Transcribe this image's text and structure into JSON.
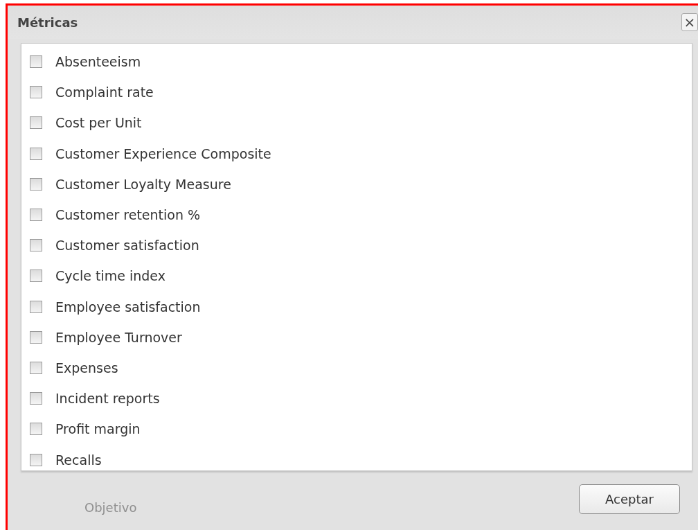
{
  "dialog": {
    "title": "Métricas",
    "close_icon": "×"
  },
  "metrics": [
    {
      "label": "Absenteeism",
      "checked": false
    },
    {
      "label": "Complaint rate",
      "checked": false
    },
    {
      "label": "Cost per Unit",
      "checked": false
    },
    {
      "label": "Customer Experience Composite",
      "checked": false
    },
    {
      "label": "Customer Loyalty Measure",
      "checked": false
    },
    {
      "label": "Customer retention %",
      "checked": false
    },
    {
      "label": "Customer satisfaction",
      "checked": false
    },
    {
      "label": "Cycle time index",
      "checked": false
    },
    {
      "label": "Employee satisfaction",
      "checked": false
    },
    {
      "label": "Employee Turnover",
      "checked": false
    },
    {
      "label": "Expenses",
      "checked": false
    },
    {
      "label": "Incident reports",
      "checked": false
    },
    {
      "label": "Profit margin",
      "checked": false
    },
    {
      "label": "Recalls",
      "checked": false
    }
  ],
  "background": {
    "label": "Objetivo"
  },
  "buttons": [
    "Aceptar"
  ]
}
